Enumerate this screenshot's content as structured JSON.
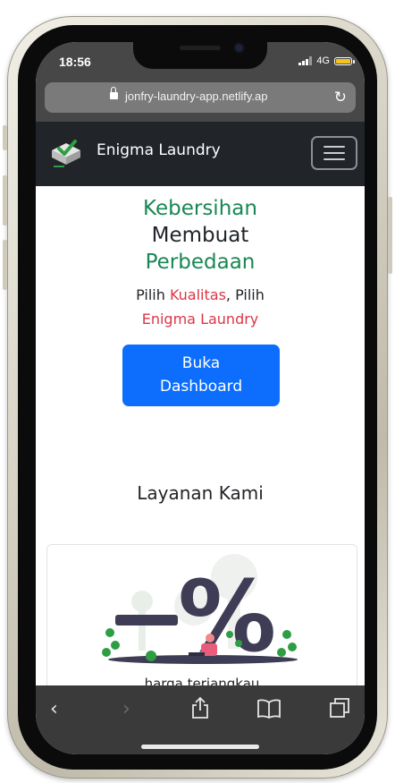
{
  "status": {
    "time": "18:56",
    "network": "4G"
  },
  "browser": {
    "url": "jonfry-laundry-app.netlify.ap"
  },
  "navbar": {
    "brand": "Enigma Laundry",
    "menu_icon": "hamburger-icon"
  },
  "hero": {
    "line1": "Kebersihan",
    "line2": "Membuat",
    "line3": "Perbedaan",
    "tag_prefix": "Pilih ",
    "tag_highlight1": "Kualitas",
    "tag_middle": ", Pilih",
    "tag_highlight2": "Enigma Laundry",
    "cta_line1": "Buka",
    "cta_line2": "Dashboard"
  },
  "services": {
    "title": "Layanan Kami",
    "card_text": "harga terjangkau"
  },
  "toolbar": {
    "back": "back-icon",
    "forward": "forward-icon",
    "share": "share-icon",
    "bookmarks": "bookmarks-icon",
    "tabs": "tabs-icon"
  },
  "colors": {
    "green": "#198754",
    "red": "#dc3545",
    "primary": "#0d6efd",
    "navbar": "#212529",
    "battery": "#f4c41c"
  }
}
